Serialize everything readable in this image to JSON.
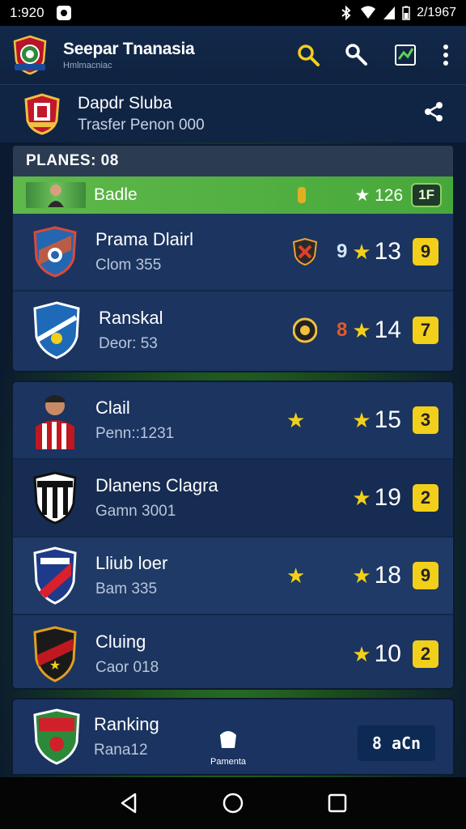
{
  "status_bar": {
    "time": "1:920",
    "battery_text": "2/1967"
  },
  "app_bar": {
    "title": "Seepar Tnanasia",
    "subtitle": "Hmlmacniac"
  },
  "sub_header": {
    "title": "Dapdr Sluba",
    "subtitle": "Trasfer Penon 000"
  },
  "players_panel": {
    "header": "PLANES: 08",
    "highlight": {
      "name": "Badle",
      "rating": "★ 126",
      "badge": "1F"
    },
    "rows": [
      {
        "name": "Prama Dlairl",
        "meta": "Clom 355",
        "extra": "9",
        "rating": "13",
        "badge": "9"
      },
      {
        "name": "Ranskal",
        "meta": "Deor: 53",
        "extra": "8",
        "rating": "14",
        "badge": "7"
      }
    ]
  },
  "club_panel": {
    "rows": [
      {
        "name": "Clail",
        "meta": "Penn::1231",
        "rating": "15",
        "badge": "3"
      },
      {
        "name": "Dlanens Clagra",
        "meta": "Gamn 3001",
        "rating": "19",
        "badge": "2"
      },
      {
        "name": "Lliub loer",
        "meta": "Bam 335",
        "rating": "18",
        "badge": "9"
      },
      {
        "name": "Cluing",
        "meta": "Caor 018",
        "rating": "10",
        "badge": "2"
      }
    ]
  },
  "bottom_panel": {
    "name": "Ranking",
    "meta": "Rana12",
    "tab_label": "Pamenta",
    "button": "8 aCn"
  },
  "colors": {
    "accent_green": "#5fb84a",
    "badge_yellow": "#f2cf1a",
    "panel_blue": "#1b3460"
  },
  "icons": [
    "search-icon",
    "key-icon",
    "chart-icon",
    "more-icon",
    "share-icon",
    "back-icon",
    "home-icon",
    "recents-icon"
  ]
}
